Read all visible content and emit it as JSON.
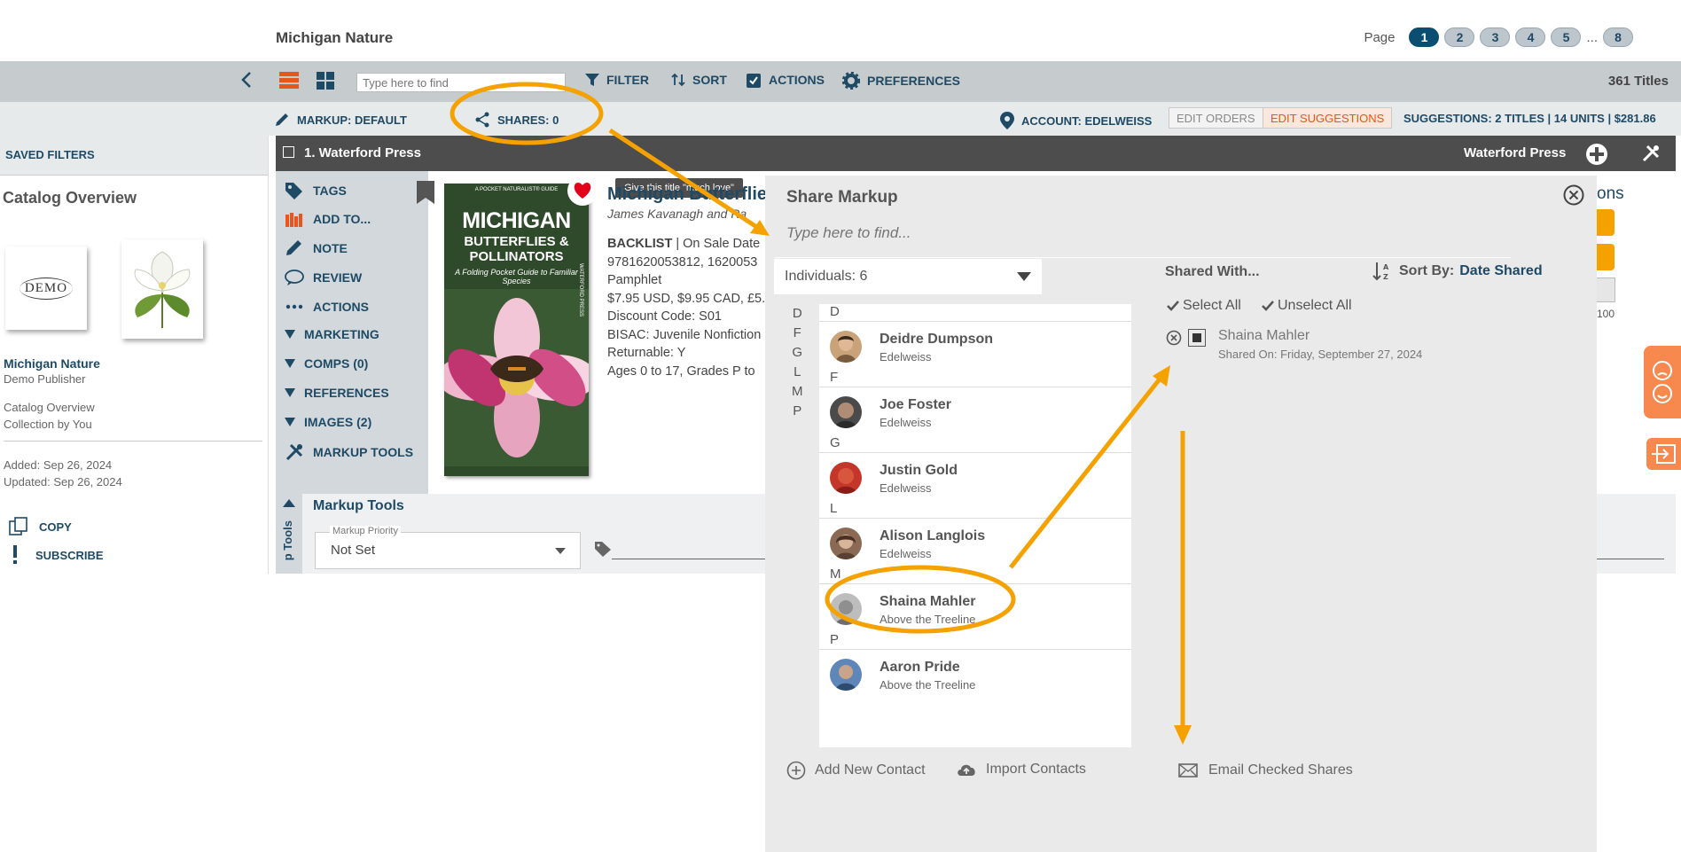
{
  "header": {
    "title": "Michigan Nature",
    "page_label": "Page",
    "pages": [
      "1",
      "2",
      "3",
      "4",
      "5",
      "8"
    ],
    "ellipsis": "...",
    "active_page": "1"
  },
  "toolbar": {
    "search_placeholder": "Type here to find",
    "filter": "FILTER",
    "sort": "SORT",
    "actions": "ACTIONS",
    "preferences": "PREFERENCES",
    "titles_count": "361 Titles"
  },
  "subbar": {
    "markup": "MARKUP: DEFAULT",
    "shares": "SHARES: 0",
    "account": "ACCOUNT: EDELWEISS",
    "edit_orders": "EDIT ORDERS",
    "edit_suggestions": "EDIT SUGGESTIONS",
    "suggestions": "SUGGESTIONS: 2 TITLES | 14 UNITS | $281.86"
  },
  "left_panel": {
    "saved_filters": "SAVED FILTERS",
    "catalog_overview": "Catalog Overview",
    "demo_logo": "DEMO",
    "catalog_name": "Michigan Nature",
    "publisher": "Demo Publisher",
    "catalog_type": "Catalog Overview",
    "collection": "Collection by You",
    "added": "Added: Sep 26, 2024",
    "updated": "Updated: Sep 26, 2024",
    "copy": "COPY",
    "subscribe": "SUBSCRIBE"
  },
  "title_bar": {
    "label": "1. Waterford Press",
    "publisher": "Waterford Press"
  },
  "row_menu": [
    "TAGS",
    "ADD TO...",
    "NOTE",
    "REVIEW",
    "ACTIONS",
    "MARKETING",
    "COMPS (0)",
    "REFERENCES",
    "IMAGES (2)",
    "MARKUP TOOLS"
  ],
  "book": {
    "cover_top": "A POCKET NATURALIST® GUIDE",
    "cover_title": "MICHIGAN",
    "cover_title2": "BUTTERFLIES & POLLINATORS",
    "cover_sub": "A Folding Pocket Guide to Familiar Species",
    "cover_spine": "WATERFORD PRESS",
    "tooltip": "Give this title \"much love\"",
    "title_frag": "Michigan Butterflie",
    "authors": "James Kavanagh and Ra",
    "backlist": "BACKLIST",
    "on_sale": " | On Sale Date",
    "isbn": "9781620053812, 1620053",
    "format": "Pamphlet",
    "price": "$7.95 USD, $9.95 CAD, £5.",
    "discount": "Discount Code: S01",
    "bisac": "BISAC: Juvenile Nonfiction",
    "returnable": "Returnable: Y",
    "ages": "Ages 0 to 17, Grades P to"
  },
  "markup_tools": {
    "heading": "Markup Tools",
    "priority_label": "Markup Priority",
    "priority_value": "Not Set",
    "side_label": "p Tools"
  },
  "right_fragments": {
    "ons": "ons",
    "hundred": "100"
  },
  "modal": {
    "title": "Share Markup",
    "search_placeholder": "Type here to find...",
    "dropdown": "Individuals: 6",
    "letters": [
      "D",
      "F",
      "G",
      "L",
      "M",
      "P"
    ],
    "contacts": [
      {
        "letter": "D",
        "name": "Deidre Dumpson",
        "org": "Edelweiss"
      },
      {
        "letter": "F",
        "name": "Joe Foster",
        "org": "Edelweiss"
      },
      {
        "letter": "G",
        "name": "Justin Gold",
        "org": "Edelweiss"
      },
      {
        "letter": "L",
        "name": "Alison Langlois",
        "org": "Edelweiss"
      },
      {
        "letter": "M",
        "name": "Shaina Mahler",
        "org": "Above the Treeline"
      },
      {
        "letter": "P",
        "name": "Aaron Pride",
        "org": "Above the Treeline"
      }
    ],
    "shared_with": "Shared With...",
    "sort_by": "Sort By:",
    "sort_value": "Date Shared",
    "select_all": "Select All",
    "unselect_all": "Unselect All",
    "shared_name": "Shaina Mahler",
    "shared_on": "Shared On: Friday, September 27, 2024",
    "add_contact": "Add New Contact",
    "import_contacts": "Import Contacts",
    "email_shares": "Email Checked Shares"
  },
  "colors": {
    "accent": "#1f4a66",
    "orange": "#f5a100",
    "active_page": "#0c4d72",
    "heart": "#e2001a",
    "edit_suggestions": "#e8561c"
  }
}
